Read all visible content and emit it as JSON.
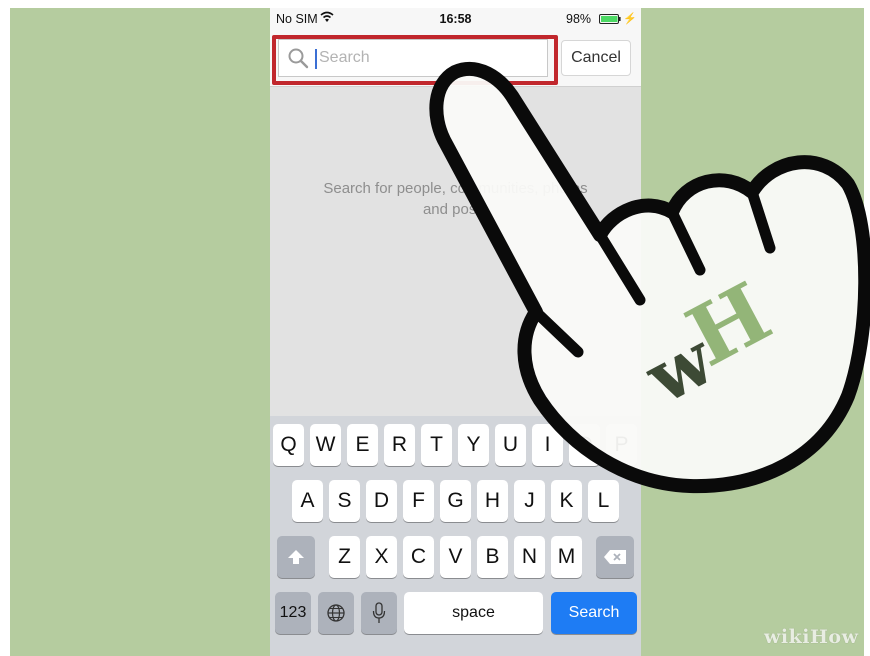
{
  "status_bar": {
    "carrier": "No SIM",
    "wifi_icon": "wifi-icon",
    "time": "16:58",
    "battery_percent": "98%",
    "battery_icon": "battery-icon",
    "charging_icon": "lightning-icon"
  },
  "search": {
    "placeholder": "Search",
    "icon": "magnifier-icon",
    "cancel_label": "Cancel",
    "highlight_color": "#c1272d"
  },
  "empty_state": {
    "line1": "Search for people, communities, photos",
    "line2": "and posts"
  },
  "keyboard": {
    "row1": [
      "Q",
      "W",
      "E",
      "R",
      "T",
      "Y",
      "U",
      "I",
      "O",
      "P"
    ],
    "row2": [
      "A",
      "S",
      "D",
      "F",
      "G",
      "H",
      "J",
      "K",
      "L"
    ],
    "row3": [
      "Z",
      "X",
      "C",
      "V",
      "B",
      "N",
      "M"
    ],
    "shift_icon": "shift-arrow-icon",
    "backspace_icon": "backspace-icon",
    "numbers_label": "123",
    "globe_icon": "globe-icon",
    "mic_icon": "microphone-icon",
    "space_label": "space",
    "search_label": "Search",
    "search_key_color": "#1e7cf4"
  },
  "overlay": {
    "hand_icon": "pointing-hand-icon",
    "badge_letters": "wH",
    "watermark": "wikiHow"
  },
  "colors": {
    "background": "#b5cc9f",
    "phone_content": "#e2e2e2",
    "keyboard": "#d2d5da"
  }
}
